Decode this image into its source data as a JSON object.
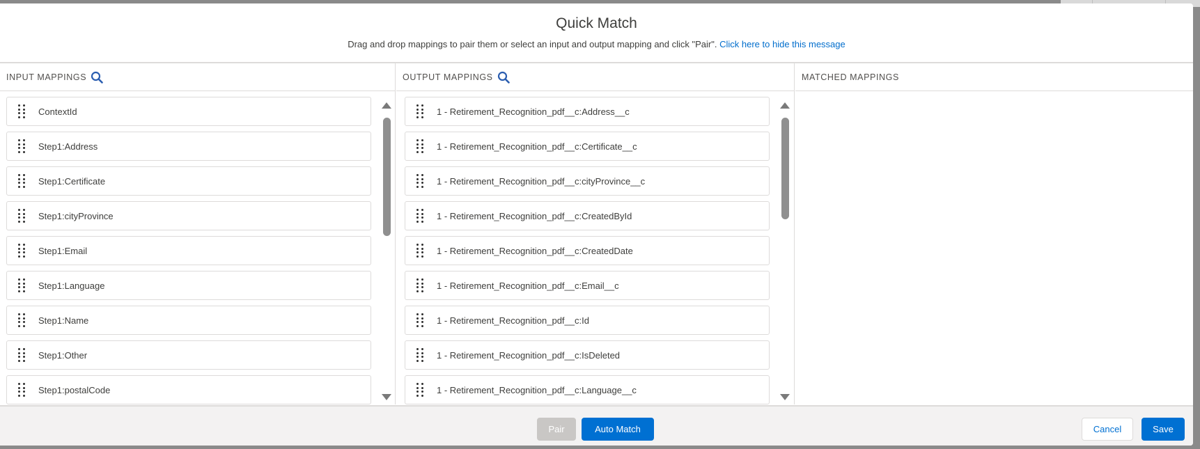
{
  "modal": {
    "title": "Quick Match",
    "instructions": "Drag and drop mappings to pair them or select an input and output mapping and click \"Pair\".",
    "hide_link": "Click here to hide this message"
  },
  "input_column": {
    "header": "INPUT MAPPINGS",
    "search_icon": "search-icon",
    "items": [
      {
        "label": "ContextId"
      },
      {
        "label": "Step1:Address"
      },
      {
        "label": "Step1:Certificate"
      },
      {
        "label": "Step1:cityProvince"
      },
      {
        "label": "Step1:Email"
      },
      {
        "label": "Step1:Language"
      },
      {
        "label": "Step1:Name"
      },
      {
        "label": "Step1:Other"
      },
      {
        "label": "Step1:postalCode"
      }
    ]
  },
  "output_column": {
    "header": "OUTPUT MAPPINGS",
    "search_icon": "search-icon",
    "items": [
      {
        "label": "1 - Retirement_Recognition_pdf__c:Address__c"
      },
      {
        "label": "1 - Retirement_Recognition_pdf__c:Certificate__c"
      },
      {
        "label": "1 - Retirement_Recognition_pdf__c:cityProvince__c"
      },
      {
        "label": "1 - Retirement_Recognition_pdf__c:CreatedById"
      },
      {
        "label": "1 - Retirement_Recognition_pdf__c:CreatedDate"
      },
      {
        "label": "1 - Retirement_Recognition_pdf__c:Email__c"
      },
      {
        "label": "1 - Retirement_Recognition_pdf__c:Id"
      },
      {
        "label": "1 - Retirement_Recognition_pdf__c:IsDeleted"
      },
      {
        "label": "1 - Retirement_Recognition_pdf__c:Language__c"
      }
    ]
  },
  "matched_column": {
    "header": "MATCHED MAPPINGS",
    "items": []
  },
  "footer": {
    "pair_label": "Pair",
    "auto_match_label": "Auto Match",
    "cancel_label": "Cancel",
    "save_label": "Save"
  },
  "colors": {
    "brand": "#0070d2",
    "link": "#006dcc",
    "disabled_button": "#c9c7c5",
    "border": "#dddbda",
    "footer_bg": "#f3f2f2"
  }
}
